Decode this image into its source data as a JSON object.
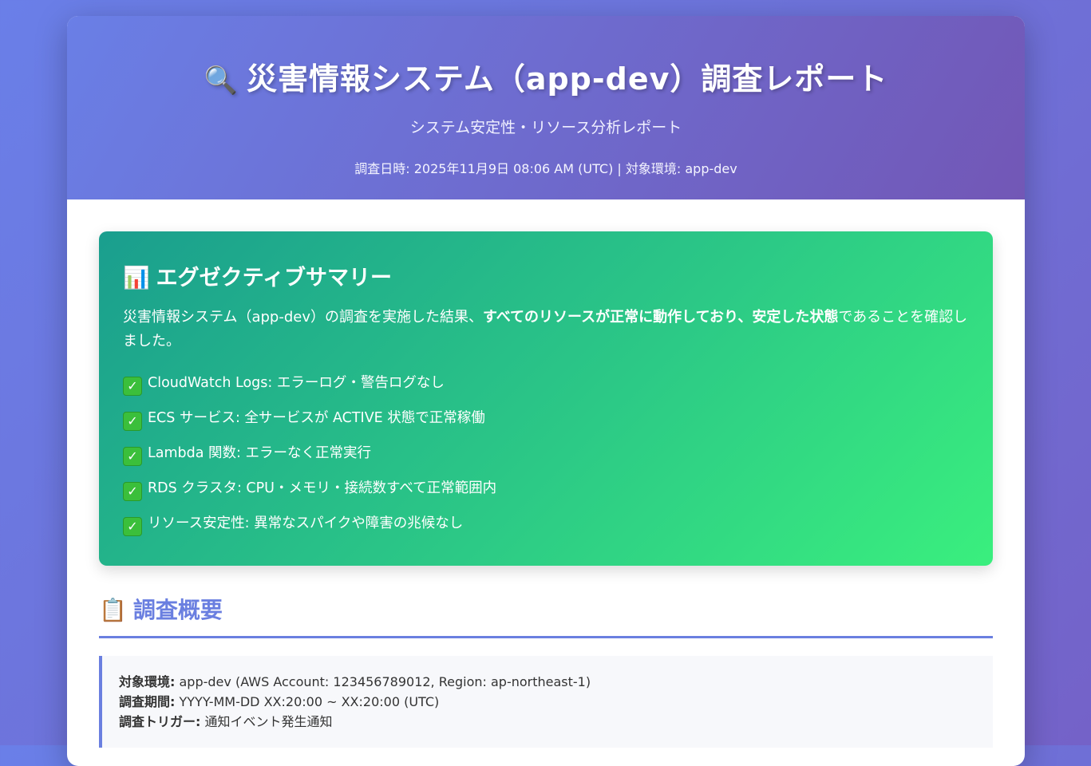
{
  "header": {
    "icon": "magnifier-icon",
    "title": "災害情報システム（app-dev）調査レポート",
    "subtitle": "システム安定性・リソース分析レポート",
    "meta": "調査日時: 2025年11月9日 08:06 AM (UTC) | 対象環境: app-dev"
  },
  "summary": {
    "icon": "bar-chart-icon",
    "title": "エグゼクティブサマリー",
    "text_before": "災害情報システム（app-dev）の調査を実施した結果、",
    "text_bold": "すべてのリソースが正常に動作しており、安定した状態",
    "text_after": "であることを確認しました。",
    "items": [
      "CloudWatch Logs: エラーログ・警告ログなし",
      "ECS サービス: 全サービスが ACTIVE 状態で正常稼働",
      "Lambda 関数: エラーなく正常実行",
      "RDS クラスタ: CPU・メモリ・接続数すべて正常範囲内",
      "リソース安定性: 異常なスパイクや障害の兆候なし"
    ]
  },
  "overview": {
    "icon": "clipboard-icon",
    "title": "調査概要",
    "rows": [
      {
        "label": "対象環境:",
        "value": "app-dev (AWS Account: 123456789012, Region: ap-northeast-1)"
      },
      {
        "label": "調査期間:",
        "value": "YYYY-MM-DD XX:20:00 ~ XX:20:00 (UTC)"
      },
      {
        "label": "調査トリガー:",
        "value": "通知イベント発生通知"
      }
    ]
  }
}
